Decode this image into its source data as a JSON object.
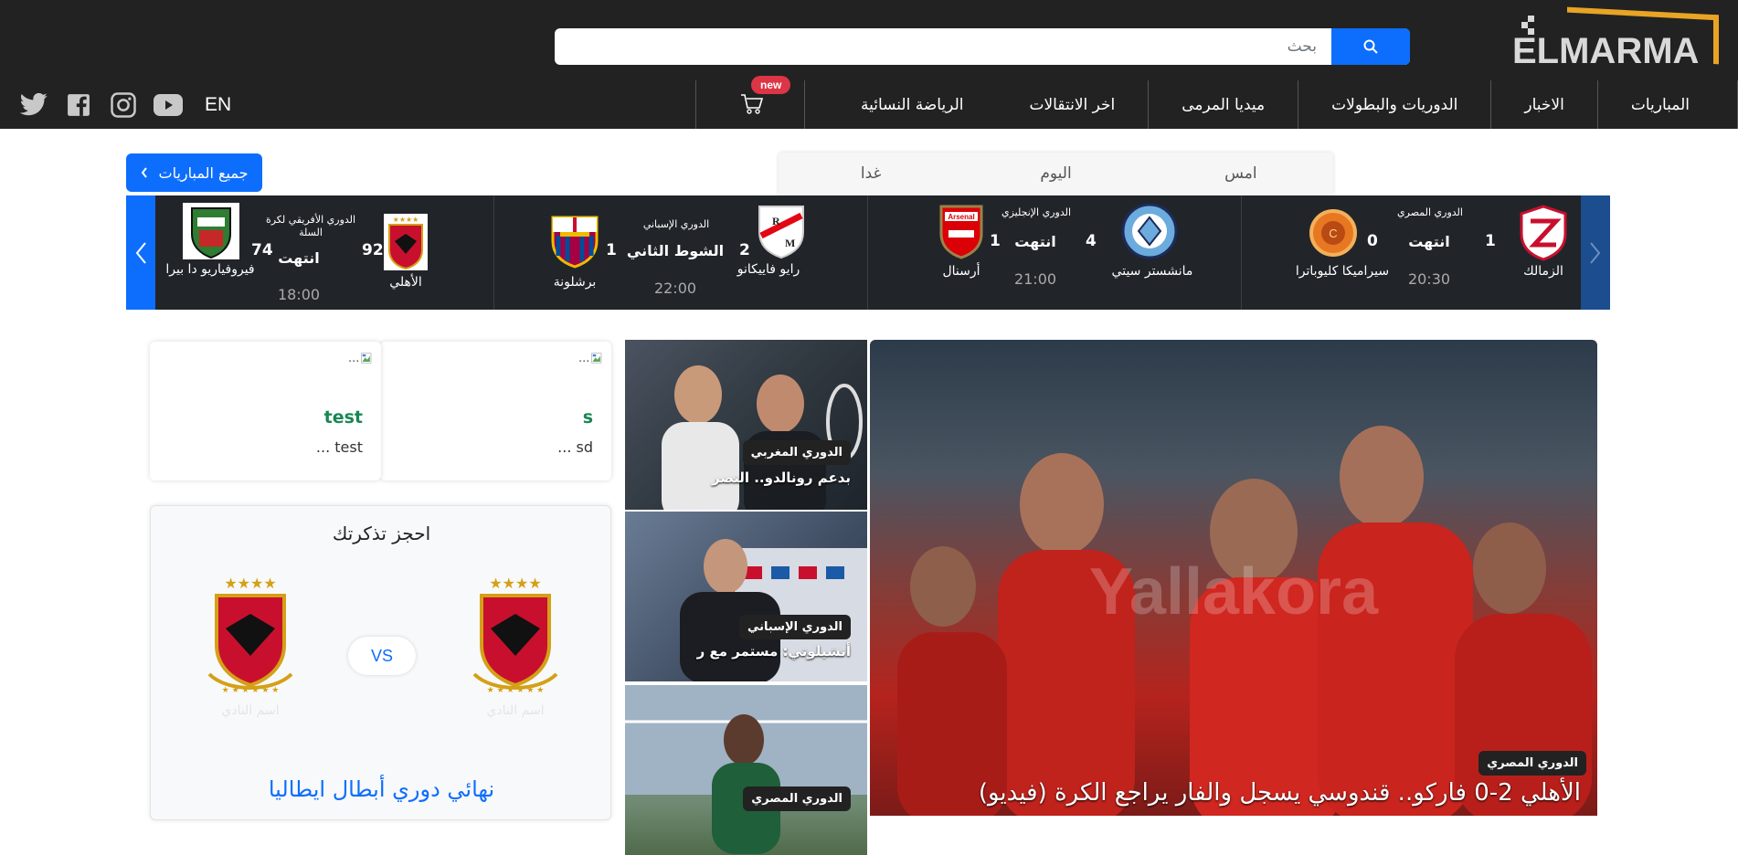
{
  "brand": {
    "logo_text": "ELMARMA",
    "accent": "#e8a424",
    "primary": "#0d6efd"
  },
  "search": {
    "placeholder": "بحث"
  },
  "nav": {
    "items": [
      "المباريات",
      "الاخبار",
      "الدوريات والبطولات",
      "ميديا المرمى",
      "اخر الانتقالات",
      "الرياضة النسائية"
    ],
    "cart_badge": "new",
    "lang": "EN",
    "socials": [
      "twitter-icon",
      "facebook-icon",
      "instagram-icon",
      "youtube-icon"
    ]
  },
  "days": {
    "yesterday": "امس",
    "today": "اليوم",
    "tomorrow": "غدا"
  },
  "all_matches": "جميع المباريات",
  "matches": [
    {
      "league": "الدوري المصري",
      "home": "الزمالك",
      "home_score": "1",
      "away": "سيراميكا كليوباترا",
      "away_score": "0",
      "status": "انتهت",
      "time": "20:30"
    },
    {
      "league": "الدوري الإنجليزي",
      "home": "مانشستر سيتي",
      "home_score": "4",
      "away": "أرسنال",
      "away_score": "1",
      "status": "انتهت",
      "time": "21:00"
    },
    {
      "league": "الدوري الإسباني",
      "home": "رايو فاييكانو",
      "home_score": "2",
      "away": "برشلونة",
      "away_score": "1",
      "status": "الشوط الثاني",
      "time": "22:00"
    },
    {
      "league": "الدوري الأفريقي لكرة السلة",
      "home": "الأهلي",
      "home_score": "92",
      "away": "فيروفياريو دا بيرا",
      "away_score": "74",
      "status": "انتهت",
      "time": "18:00"
    }
  ],
  "hero": {
    "tag": "الدوري المصري",
    "headline": "الأهلي 2-0 فاركو.. قندوسي يسجل والفار يراجع الكرة (فيديو)"
  },
  "thumbs": [
    {
      "tag": "الدوري المغربي",
      "title": "بدعم رونالدو.. النصر"
    },
    {
      "tag": "الدوري الإسباني",
      "title": "أنشيلوتي: مستمر مع ر"
    },
    {
      "tag": "الدوري المصري",
      "title": ""
    }
  ],
  "cards": [
    {
      "img_alt": "...",
      "title": "s",
      "sub": "sd ..."
    },
    {
      "img_alt": "...",
      "title": "test",
      "sub": "test ..."
    }
  ],
  "ticket": {
    "title": "احجز تذكرتك",
    "vs": "VS",
    "club_placeholder": "اسم النادي",
    "final": "نهائي دوري أبطال ايطاليا"
  }
}
